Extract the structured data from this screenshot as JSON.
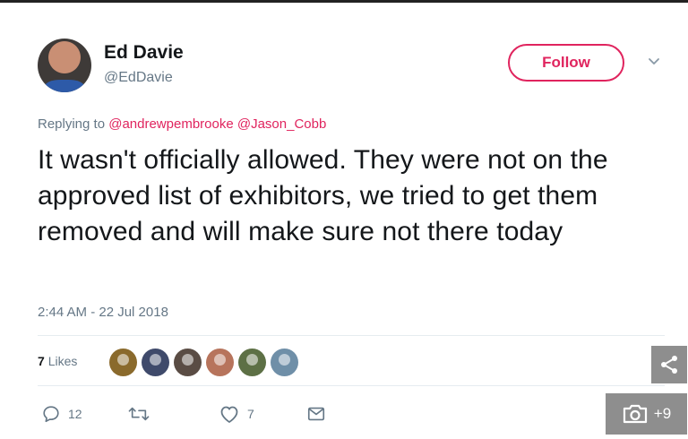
{
  "tweet": {
    "author": {
      "display_name": "Ed Davie",
      "handle": "@EdDavie"
    },
    "follow_label": "Follow",
    "replying_to_prefix": "Replying to",
    "mention_1": "@andrewpembrooke",
    "mention_2": "@Jason_Cobb",
    "text": "It wasn't officially allowed. They were not on the approved list of exhibitors, we tried to get them removed and will make sure not there today",
    "timestamp": "2:44 AM - 22 Jul 2018",
    "likes_count": "7",
    "likes_label": "Likes",
    "liker_avatar_colors": [
      "#8a6a2c",
      "#3f4a6b",
      "#5a4c44",
      "#b7745c",
      "#5d7045",
      "#6f8fa8"
    ],
    "actions": {
      "reply_count": "12",
      "retweet_count": "",
      "like_count": "7"
    }
  },
  "overlay": {
    "gallery_count": "+9",
    "share_icon": "share-icon",
    "camera_icon": "camera-icon"
  },
  "colors": {
    "accent": "#e0245e",
    "secondary_text": "#657786",
    "overlay_gray": "#8e8e8e"
  }
}
